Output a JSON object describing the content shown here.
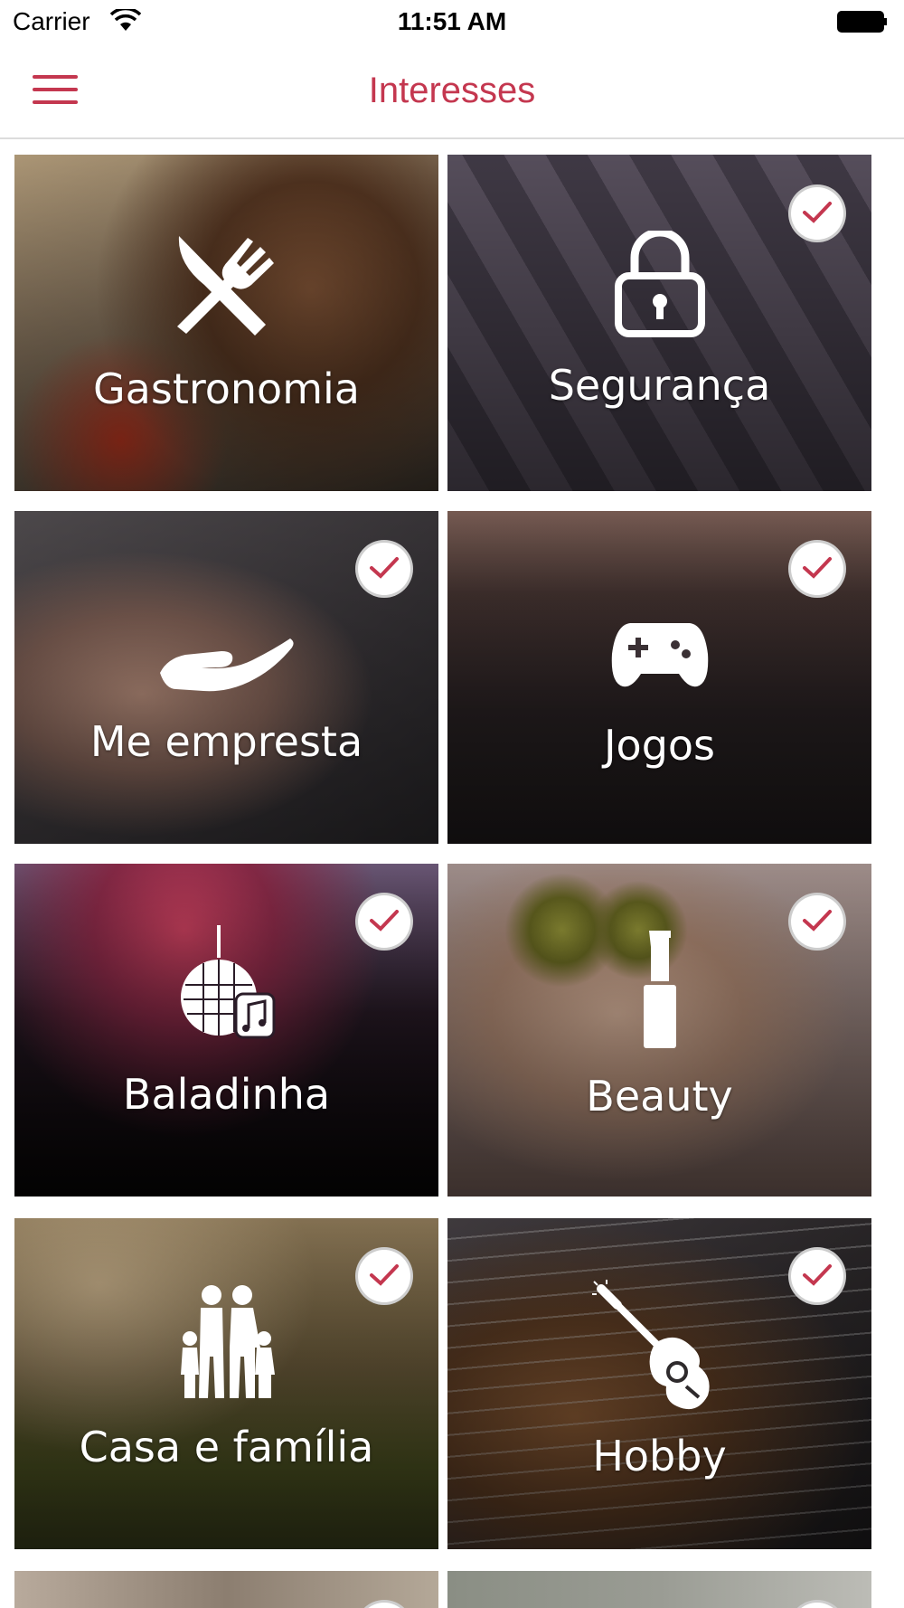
{
  "status_bar": {
    "carrier": "Carrier",
    "time": "11:51 AM"
  },
  "header": {
    "title": "Interesses",
    "menu_icon": "hamburger-menu-icon"
  },
  "colors": {
    "accent": "#c4374f",
    "tile_label": "#ffffff",
    "check_badge_bg": "#ffffff"
  },
  "categories": [
    {
      "label": "Gastronomia",
      "icon": "cutlery-icon",
      "selected": false
    },
    {
      "label": "Segurança",
      "icon": "lock-icon",
      "selected": true
    },
    {
      "label": "Me empresta",
      "icon": "hand-icon",
      "selected": true
    },
    {
      "label": "Jogos",
      "icon": "gamepad-icon",
      "selected": true
    },
    {
      "label": "Baladinha",
      "icon": "disco-ball-icon",
      "selected": true
    },
    {
      "label": "Beauty",
      "icon": "lipstick-icon",
      "selected": true
    },
    {
      "label": "Casa e família",
      "icon": "family-icon",
      "selected": true
    },
    {
      "label": "Hobby",
      "icon": "guitar-icon",
      "selected": true
    },
    {
      "label": "",
      "icon": "",
      "selected": true
    },
    {
      "label": "",
      "icon": "",
      "selected": true
    }
  ]
}
